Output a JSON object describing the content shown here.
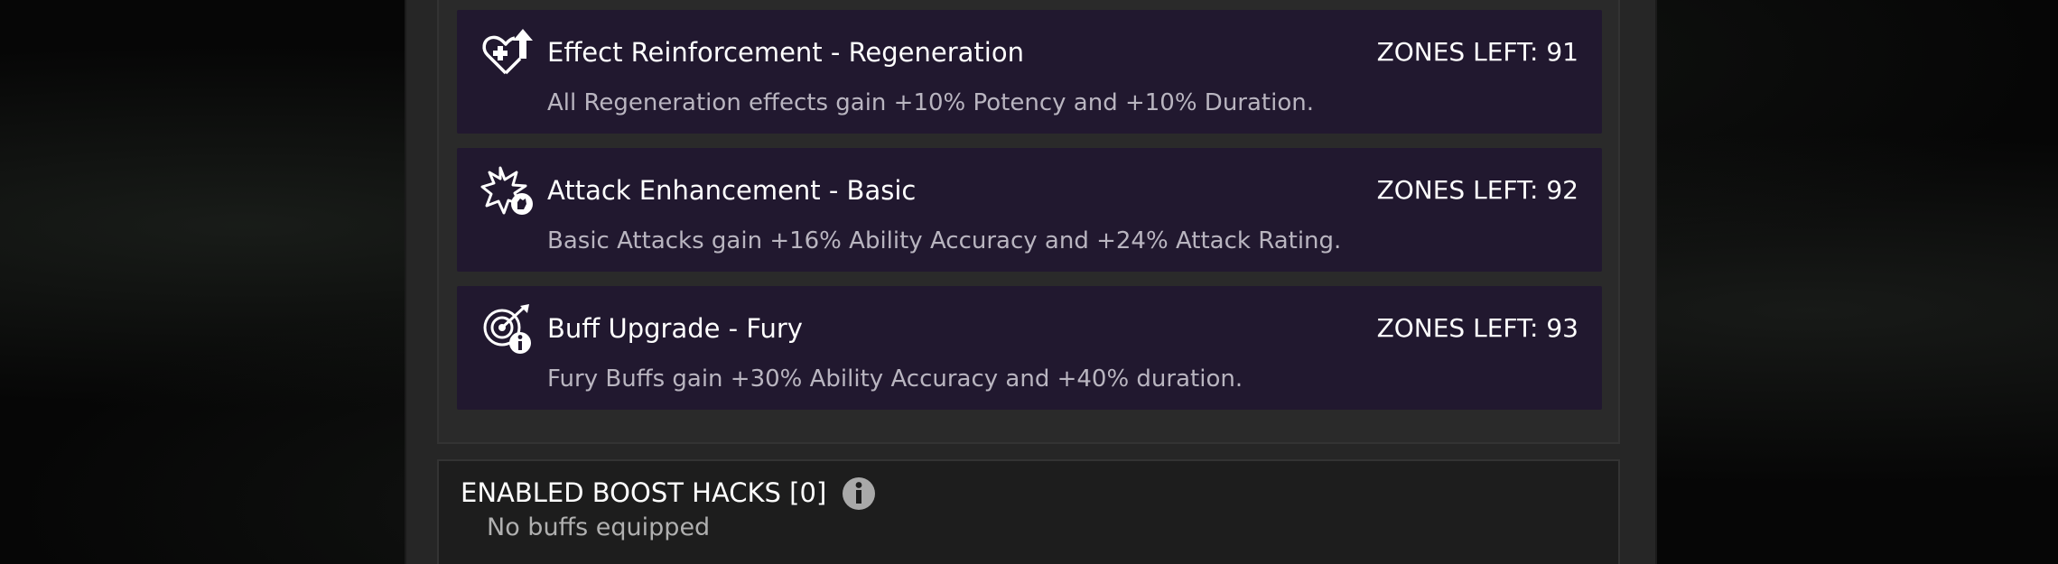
{
  "colors": {
    "card_background": "#21182f",
    "panel_background": "#2a2a2a",
    "boost_panel_background": "#1d1d1d",
    "title_text": "#ffffff",
    "description_text": "#b9b5c0"
  },
  "hacks": [
    {
      "icon": "heart-plus-arrow-icon",
      "title": "Effect Reinforcement - Regeneration",
      "zones_left": "ZONES LEFT: 91",
      "description": "All Regeneration effects gain +10% Potency and +10% Duration."
    },
    {
      "icon": "star-burst-fist-icon",
      "title": "Attack Enhancement - Basic",
      "zones_left": "ZONES LEFT: 92",
      "description": "Basic Attacks gain +16% Ability Accuracy and +24% Attack Rating."
    },
    {
      "icon": "target-arrow-info-icon",
      "title": "Buff Upgrade - Fury",
      "zones_left": "ZONES LEFT: 93",
      "description": "Fury Buffs gain +30% Ability Accuracy and +40% duration."
    }
  ],
  "enabled_boost_hacks": {
    "title": "ENABLED BOOST HACKS [0]",
    "info_icon": "info-icon",
    "empty_text": "No buffs equipped"
  }
}
